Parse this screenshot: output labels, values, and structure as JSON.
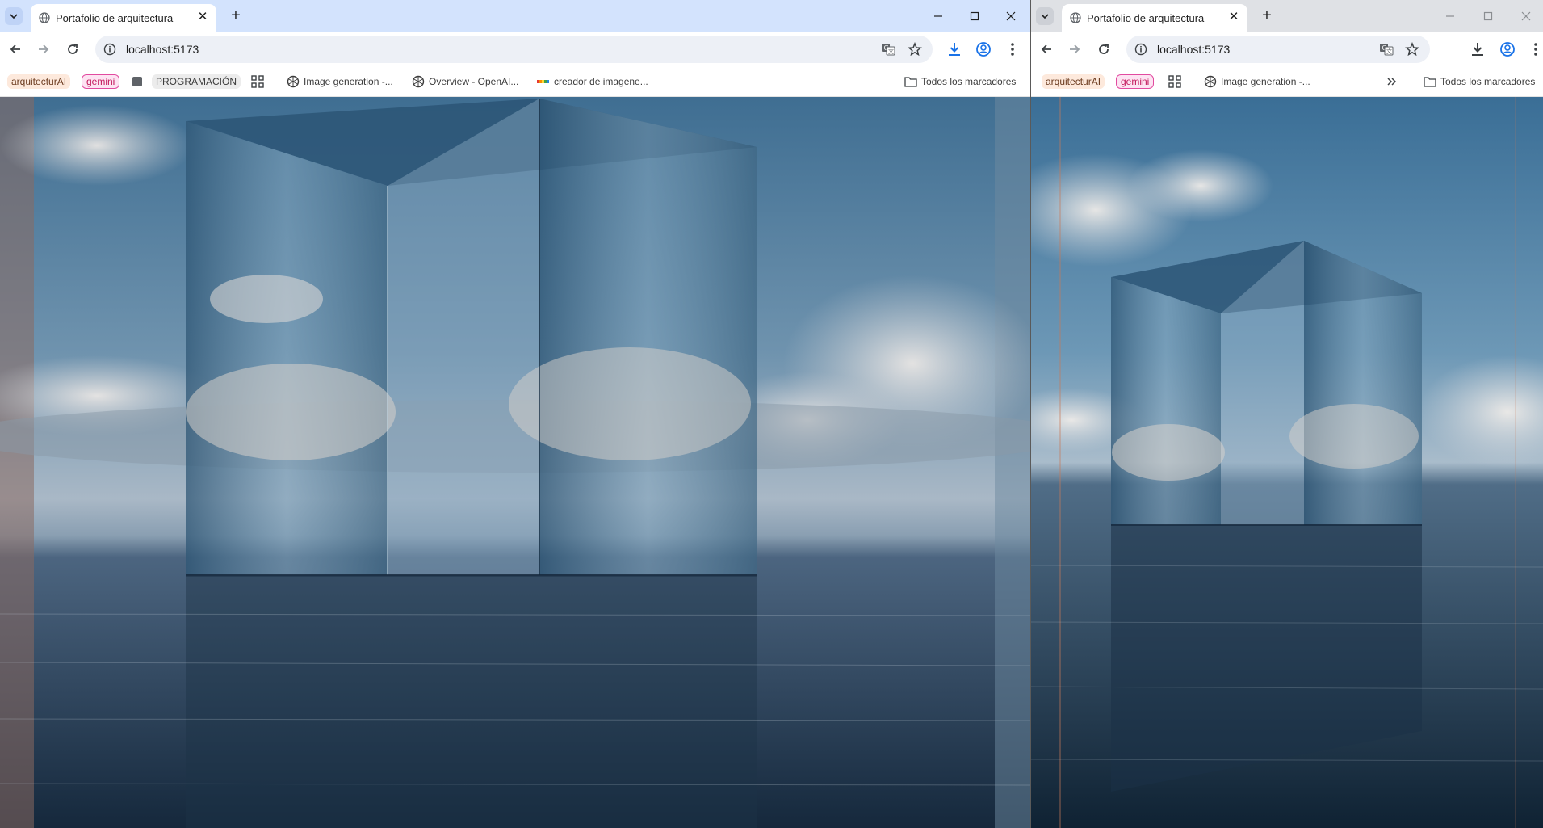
{
  "windows": [
    {
      "id": "A",
      "tab": {
        "title": "Portafolio de arquitectura"
      },
      "address": {
        "url": "localhost:5173"
      },
      "bookmarks": [
        {
          "label": "arquitecturAI",
          "style": "pill-arq"
        },
        {
          "label": "gemini",
          "style": "pill-gem"
        },
        {
          "label": "",
          "style": "square"
        },
        {
          "label": "PROGRAMACIÓN",
          "style": "pill-prog"
        },
        {
          "label": "",
          "style": "apps"
        },
        {
          "label": "Image generation -...",
          "style": "openai"
        },
        {
          "label": "Overview - OpenAI...",
          "style": "openai"
        },
        {
          "label": "creador de imagene...",
          "style": "rainbow"
        }
      ],
      "all_bookmarks": "Todos los marcadores"
    },
    {
      "id": "B",
      "tab": {
        "title": "Portafolio de arquitectura"
      },
      "address": {
        "url": "localhost:5173"
      },
      "bookmarks": [
        {
          "label": "arquitecturAI",
          "style": "pill-arq"
        },
        {
          "label": "gemini",
          "style": "pill-gem"
        },
        {
          "label": "",
          "style": "apps"
        },
        {
          "label": "Image generation -...",
          "style": "openai"
        }
      ],
      "all_bookmarks": "Todos los marcadores"
    }
  ],
  "colors": {
    "tabstrip_active": "#d3e3fd",
    "tabstrip_inactive": "#dfe1e5",
    "download_accent": "#1a73e8",
    "sky_top": "#4f7ea0",
    "sea": "#2a3d52"
  },
  "icons": [
    "tab-search-icon",
    "globe-icon",
    "close-icon",
    "plus-icon",
    "minimize-icon",
    "maximize-icon",
    "back-arrow-icon",
    "forward-arrow-icon",
    "reload-icon",
    "info-icon",
    "translate-icon",
    "star-icon",
    "download-icon",
    "profile-icon",
    "kebab-menu-icon",
    "folder-icon",
    "apps-grid-icon",
    "openai-logo-icon",
    "chevron-double-right-icon"
  ]
}
